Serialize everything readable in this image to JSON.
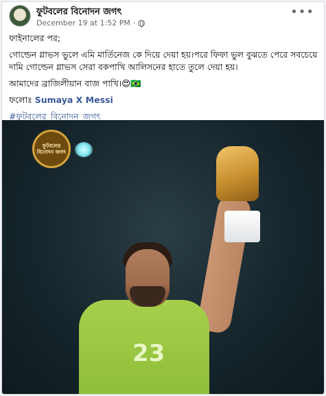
{
  "header": {
    "page_name": "ফুটবলের বিনোদন জগৎ",
    "timestamp": "December 19 at 1:52 PM",
    "separator": "·",
    "more": "•••"
  },
  "post": {
    "line1": "ফাইনালের পর;",
    "line2": "গোল্ডেন গ্লাভস ভুলে এমি মার্তিনেজ কে দিয়ে দেয়া হয়।পরে ফিফা ভুল বুঝতে পেরে সবচেয়ে দামি গোল্ডেন গ্লাভস সেরা বকপাখি আলিসনের হাতে তুলে দেয়া হয়।",
    "line3": "আমাদের ব্রাজিলীয়ান বাজ পাখি।😍🇧🇷",
    "follow_label": "ফলোঃ",
    "follow_name": "Sumaya X Messi",
    "hashtag": "#ফুটবলের_বিনোদন_জগৎ"
  },
  "photo": {
    "badge_text": "ফুটবলের বিনোদন জগৎ",
    "jersey_number": "23"
  },
  "colors": {
    "link": "#385898",
    "meta": "#65676b",
    "jersey": "#9cc941"
  },
  "icons": [
    "globe-icon",
    "more-options-icon"
  ]
}
